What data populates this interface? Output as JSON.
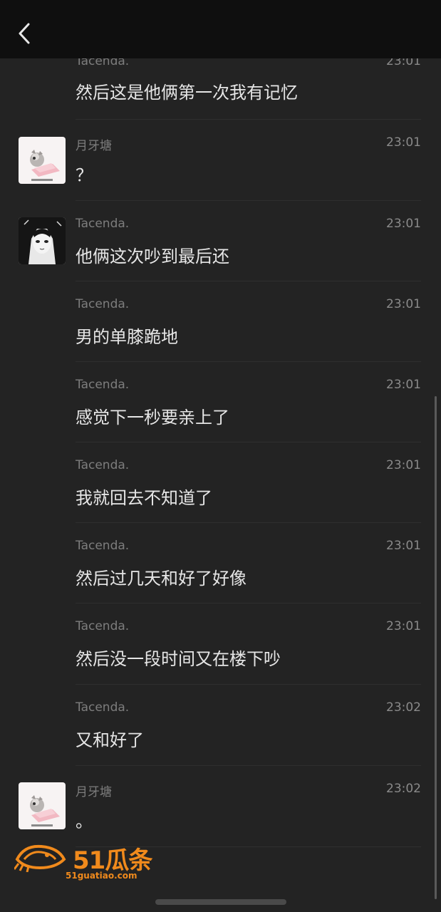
{
  "colors": {
    "background": "#232323",
    "topbar": "#0f0f0f",
    "message_text": "#e6e6e6",
    "meta_text": "#8a8a8a",
    "watermark": "#f08a1c"
  },
  "header": {
    "back_icon": "chevron-left-icon"
  },
  "messages": [
    {
      "sender": "Tacenda.",
      "time": "23:01",
      "text": "然后这是他俩第一次我有记忆",
      "avatar": null
    },
    {
      "sender": "月牙塘",
      "time": "23:01",
      "text": "？",
      "avatar": "cat-avatar"
    },
    {
      "sender": "Tacenda.",
      "time": "23:01",
      "text": "他俩这次吵到最后还",
      "avatar": "anime-girl-avatar"
    },
    {
      "sender": "Tacenda.",
      "time": "23:01",
      "text": "男的单膝跪地",
      "avatar": null
    },
    {
      "sender": "Tacenda.",
      "time": "23:01",
      "text": "感觉下一秒要亲上了",
      "avatar": null
    },
    {
      "sender": "Tacenda.",
      "time": "23:01",
      "text": "我就回去不知道了",
      "avatar": null
    },
    {
      "sender": "Tacenda.",
      "time": "23:01",
      "text": "然后过几天和好了好像",
      "avatar": null
    },
    {
      "sender": "Tacenda.",
      "time": "23:01",
      "text": "然后没一段时间又在楼下吵",
      "avatar": null
    },
    {
      "sender": "Tacenda.",
      "time": "23:02",
      "text": "又和好了",
      "avatar": null
    },
    {
      "sender": "月牙塘",
      "time": "23:02",
      "text": "。",
      "avatar": "cat-avatar"
    }
  ],
  "watermark": {
    "logo_text": "51瓜条",
    "url": "51guatiao.com"
  }
}
